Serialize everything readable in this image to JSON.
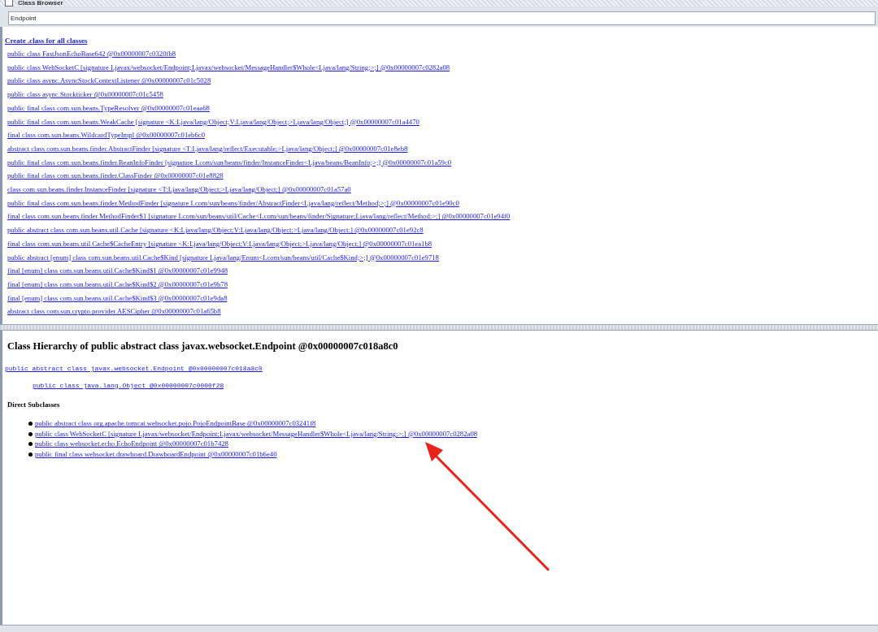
{
  "window": {
    "title": "Class Browser"
  },
  "search": {
    "value": "Endpoint"
  },
  "class_list": {
    "create_link": "Create .class for all classes",
    "items": [
      "public class FastJsonEchoBase642 @0x00000007c0320fb8",
      "public class WebSocketC [signature Ljavax/websocket/Endpoint;Ljavax/websocket/MessageHandler$Whole<Ljava/lang/String;>;] @0x00000007c0282a08",
      "public class async.AsyncStockContextListener @0x00000007c01c5028",
      "public class async.Stockticker @0x00000007c01c5458",
      "public final class com.sun.beans.TypeResolver @0x00000007c01eaa68",
      "public final class com.sun.beans.WeakCache [signature <K:Ljava/lang/Object;V:Ljava/lang/Object;>Ljava/lang/Object;] @0x00000007c01a4470",
      "final class com.sun.beans.WildcardTypeImpl @0x00000007c01eb6c0",
      "abstract class com.sun.beans.finder.AbstractFinder [signature <T:Ljava/lang/reflect/Executable;>Ljava/lang/Object;] @0x00000007c01e8eb8",
      "public final class com.sun.beans.finder.BeanInfoFinder [signature Lcom/sun/beans/finder/InstanceFinder<Ljava/beans/BeanInfo;>;] @0x00000007c01a59c0",
      "public final class com.sun.beans.finder.ClassFinder @0x00000007c01e8828",
      "class com.sun.beans.finder.InstanceFinder [signature <T:Ljava/lang/Object;>Ljava/lang/Object;] @0x00000007c01a57a0",
      "public final class com.sun.beans.finder.MethodFinder [signature Lcom/sun/beans/finder/AbstractFinder<Ljava/lang/reflect/Method;>;] @0x00000007c01e90c0",
      "final class com.sun.beans.finder.MethodFinder$1 [signature Lcom/sun/beans/util/Cache<Lcom/sun/beans/finder/Signature;Ljava/lang/reflect/Method;>;] @0x00000007c01e94f0",
      "public abstract class com.sun.beans.util.Cache [signature <K:Ljava/lang/Object;V:Ljava/lang/Object;>Ljava/lang/Object;] @0x00000007c01e92c8",
      "final class com.sun.beans.util.Cache$CacheEntry [signature <K:Ljava/lang/Object;V:Ljava/lang/Object;>Ljava/lang/Object;] @0x00000007c01ea1b8",
      "public abstract [enum] class com.sun.beans.util.Cache$Kind [signature Ljava/lang/Enum<Lcom/sun/beans/util/Cache$Kind;>;] @0x00000007c01e9718",
      "final [enum] class com.sun.beans.util.Cache$Kind$1 @0x00000007c01e9948",
      "final [enum] class com.sun.beans.util.Cache$Kind$2 @0x00000007c01e9b78",
      "final [enum] class com.sun.beans.util.Cache$Kind$3 @0x00000007c01e9da8",
      "abstract class com.sun.crypto.provider.AESCipher @0x00000007c01a65b8"
    ]
  },
  "hierarchy": {
    "title": "Class Hierarchy of public abstract class javax.websocket.Endpoint @0x00000007c018a8c0",
    "chain": [
      "public abstract class javax.websocket.Endpoint @0x00000007c018a8c0",
      "public class java.lang.Object @0x00000007c0000f28"
    ],
    "subclasses_heading": "Direct Subclasses",
    "subclasses": [
      "public abstract class org.apache.tomcat.websocket.pojo.PojoEndpointBase @0x00000007c03241f8",
      "public class WebSocketC [signature Ljavax/websocket/Endpoint;Ljavax/websocket/MessageHandler$Whole<Ljava/lang/String;>;] @0x00000007c0282a08",
      "public class websocket.echo.EchoEndpoint @0x00000007c01b7428",
      "public final class websocket.drawboard.DrawboardEndpoint @0x00000007c01b6e40"
    ]
  }
}
